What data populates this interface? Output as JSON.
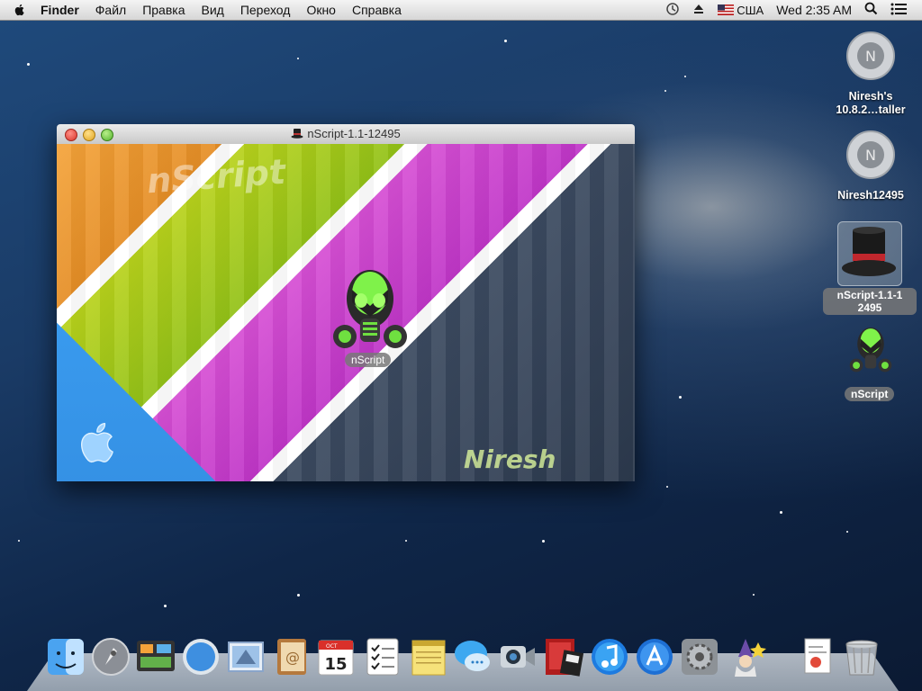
{
  "menubar": {
    "app_name": "Finder",
    "items": [
      "Файл",
      "Правка",
      "Вид",
      "Переход",
      "Окно",
      "Справка"
    ],
    "input_source": "США",
    "clock": "Wed 2:35 AM"
  },
  "window": {
    "title": "nScript-1.1-12495",
    "watermark_top": "nScript",
    "watermark_bottom": "Niresh",
    "icon_label": "nScript"
  },
  "desktop": {
    "icons": [
      {
        "label": "Niresh's\n10.8.2…taller",
        "icon": "disk-icon"
      },
      {
        "label": "Niresh12495",
        "icon": "disk-icon"
      },
      {
        "label": "nScript-1.1-1\n2495",
        "icon": "top-hat-icon"
      },
      {
        "label": "nScript",
        "icon": "gas-mask-icon"
      }
    ]
  },
  "dock": {
    "items": [
      "finder",
      "launchpad",
      "mission-control",
      "safari",
      "mail",
      "contacts",
      "calendar",
      "reminders",
      "notes",
      "messages",
      "facetime",
      "photo-booth",
      "itunes",
      "app-store",
      "system-preferences",
      "wizard",
      "documents",
      "trash"
    ],
    "calendar_day": "15",
    "calendar_month": "OCT"
  },
  "colors": {
    "orange": "#f0a03a",
    "green": "#a8cc1c",
    "magenta": "#cc44cc",
    "navy": "#35455c",
    "blue": "#3a9cf0"
  }
}
